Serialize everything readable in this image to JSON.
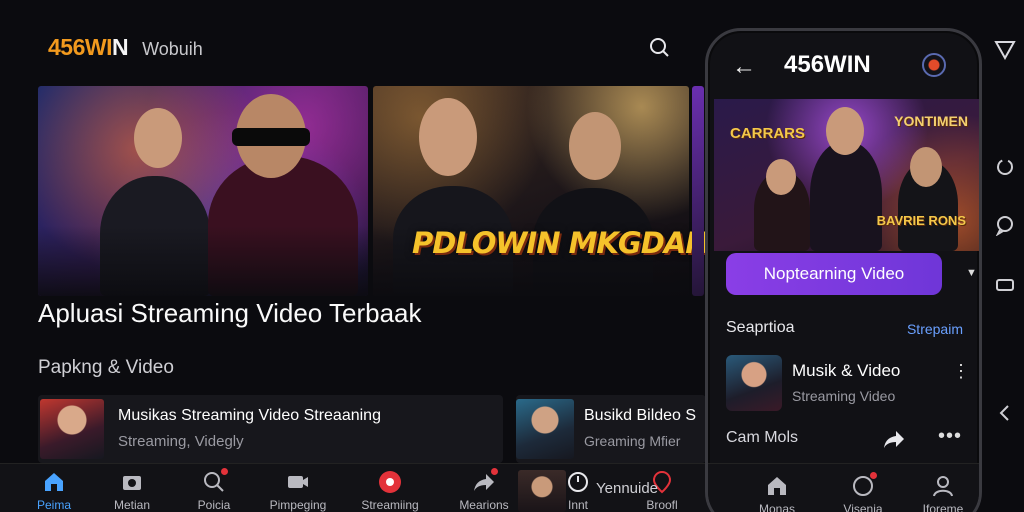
{
  "header": {
    "brand_part1": "456WI",
    "brand_part2": "N",
    "brand_sub": "Wobuih"
  },
  "banners": {
    "logo_text": "PDLOWIN MKGDAN"
  },
  "hero": {
    "title": "Apluasi Streaming Video Terbaak"
  },
  "section": {
    "title": "Papkng & Video"
  },
  "cards": [
    {
      "title": "Musikas Streaming Video Streaaning",
      "subtitle": "Streaming, Videgly"
    },
    {
      "title": "Busikd Bildeo S",
      "subtitle": "Greaming Mfier"
    }
  ],
  "bottom_nav": [
    {
      "label": "Peima",
      "icon": "home-icon"
    },
    {
      "label": "Metian",
      "icon": "camera-icon"
    },
    {
      "label": "Poicia",
      "icon": "search-icon"
    },
    {
      "label": "Pimpeging",
      "icon": "video-icon"
    },
    {
      "label": "Streamiing",
      "icon": "live-icon"
    },
    {
      "label": "Mearions",
      "icon": "share-icon"
    },
    {
      "label": "Innt",
      "icon": "clock-icon"
    },
    {
      "label": "Broofl",
      "icon": "location-icon"
    }
  ],
  "mini_player": {
    "label": "Yennuide"
  },
  "phone": {
    "title": "456WIN",
    "poster": {
      "text_left": "CARRARS",
      "text_right": "YONTIMEN",
      "text_bottom": "BAVRIE RONS"
    },
    "cta_label": "Noptearning Video",
    "section_title": "Seaprtioa",
    "section_link": "Strepaim",
    "item": {
      "title": "Musik & Video",
      "subtitle": "Streaming Video"
    },
    "row_label": "Cam Mols",
    "nav": [
      {
        "label": "Monas",
        "icon": "home-icon"
      },
      {
        "label": "Visenia",
        "icon": "circle-icon"
      },
      {
        "label": "Iforeme",
        "icon": "profile-icon"
      }
    ]
  },
  "colors": {
    "accent": "#f29a1e",
    "cta": "#7b3ae0",
    "link": "#6aa0ff",
    "active_nav": "#49a3ff",
    "notification": "#e3323a"
  }
}
